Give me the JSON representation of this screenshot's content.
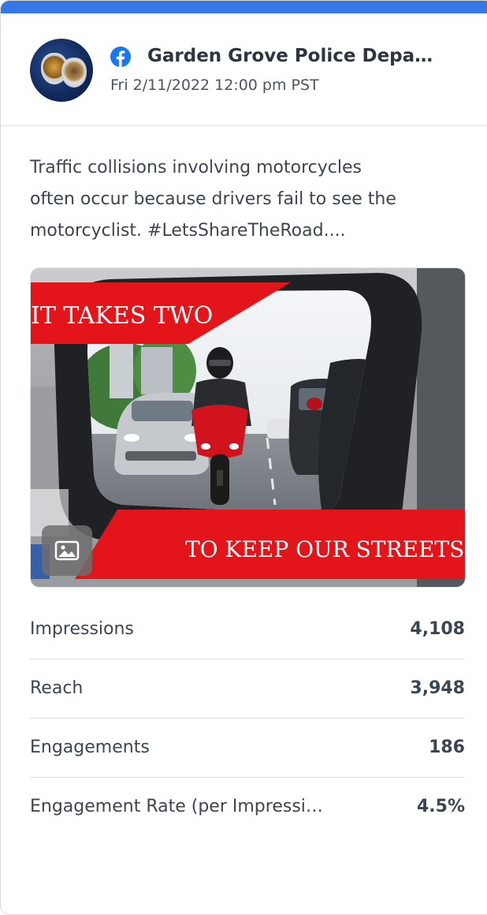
{
  "post": {
    "network_icon": "facebook-icon",
    "page_name": "Garden Grove Police Depa…",
    "date": "Fri 2/11/2022 12:00 pm PST",
    "message_lines": [
      "Traffic collisions involving motorcycles",
      "often occur because drivers fail to see the",
      "motorcyclist. #LetsShareTheRoad...."
    ],
    "image": {
      "banner_top": "IT TAKES TWO",
      "banner_bottom": "TO KEEP OUR STREETS SAF",
      "media_type_icon": "image-icon"
    }
  },
  "metrics": [
    {
      "label": "Impressions",
      "value": "4,108"
    },
    {
      "label": "Reach",
      "value": "3,948"
    },
    {
      "label": "Engagements",
      "value": "186"
    },
    {
      "label": "Engagement Rate (per Impressi…",
      "value": "4.5%"
    }
  ],
  "colors": {
    "accent": "#3578e5",
    "facebook_blue": "#1877f2",
    "banner_red": "#e3151b",
    "text": "#3c4650"
  }
}
